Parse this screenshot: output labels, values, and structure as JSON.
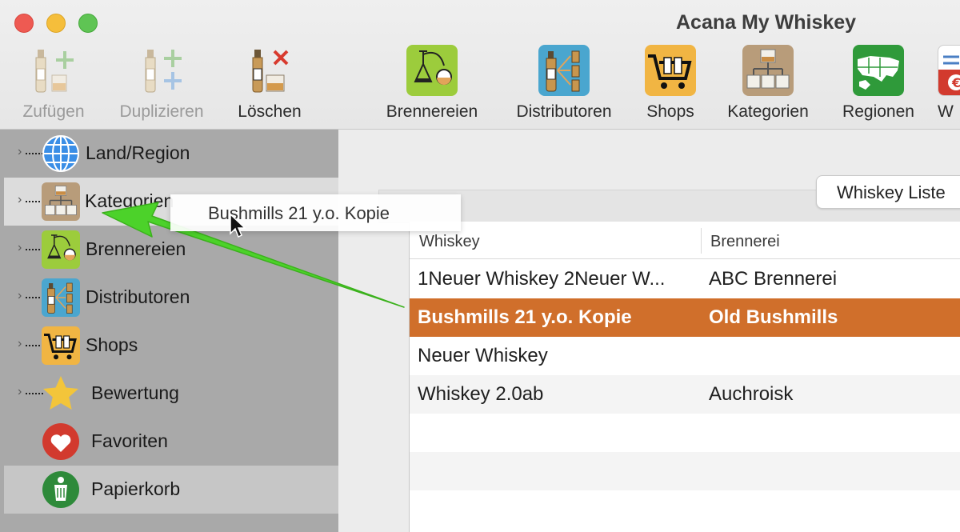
{
  "window": {
    "title": "Acana My Whiskey"
  },
  "toolbar": {
    "add_label": "Zufügen",
    "duplicate_label": "Duplizieren",
    "delete_label": "Löschen",
    "distilleries_label": "Brennereien",
    "distributors_label": "Distributoren",
    "shops_label": "Shops",
    "categories_label": "Kategorien",
    "regions_label": "Regionen",
    "partial_label": "W"
  },
  "sidebar": {
    "items": [
      {
        "label": "Land/Region"
      },
      {
        "label": "Kategorien"
      },
      {
        "label": "Brennereien"
      },
      {
        "label": "Distributoren"
      },
      {
        "label": "Shops"
      },
      {
        "label": "Bewertung"
      },
      {
        "label": "Favoriten"
      },
      {
        "label": "Papierkorb"
      }
    ]
  },
  "main": {
    "list_button": "Whiskey Liste",
    "columns": [
      "Whiskey",
      "Brennerei"
    ],
    "rows": [
      {
        "whiskey": "1Neuer Whiskey 2Neuer W...",
        "distillery": "ABC Brennerei"
      },
      {
        "whiskey": "Bushmills 21 y.o. Kopie",
        "distillery": "Old Bushmills"
      },
      {
        "whiskey": "Neuer Whiskey",
        "distillery": ""
      },
      {
        "whiskey": "Whiskey 2.0ab",
        "distillery": "Auchroisk"
      }
    ]
  },
  "drag": {
    "label": "Bushmills 21 y.o. Kopie"
  },
  "colors": {
    "selected_row": "#d06f2b",
    "drag_arrow": "#4cd22a",
    "sidebar_bg": "#a9a9a9"
  }
}
